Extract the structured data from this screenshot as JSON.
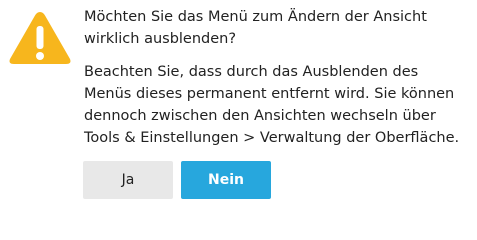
{
  "dialog": {
    "icon": "warning-icon",
    "question": "Möchten Sie das Menü zum Ändern der Ansicht wirklich ausblenden?",
    "note": "Beachten Sie, dass durch das Ausblenden des Menüs dieses permanent entfernt wird. Sie können dennoch zwischen den Ansichten wechseln über Tools & Einstellungen > Verwaltung der Oberfläche.",
    "yes_label": "Ja",
    "no_label": "Nein"
  },
  "colors": {
    "warning": "#f7b61d",
    "primary_button": "#27a7dd",
    "secondary_button": "#e8e8e8"
  }
}
